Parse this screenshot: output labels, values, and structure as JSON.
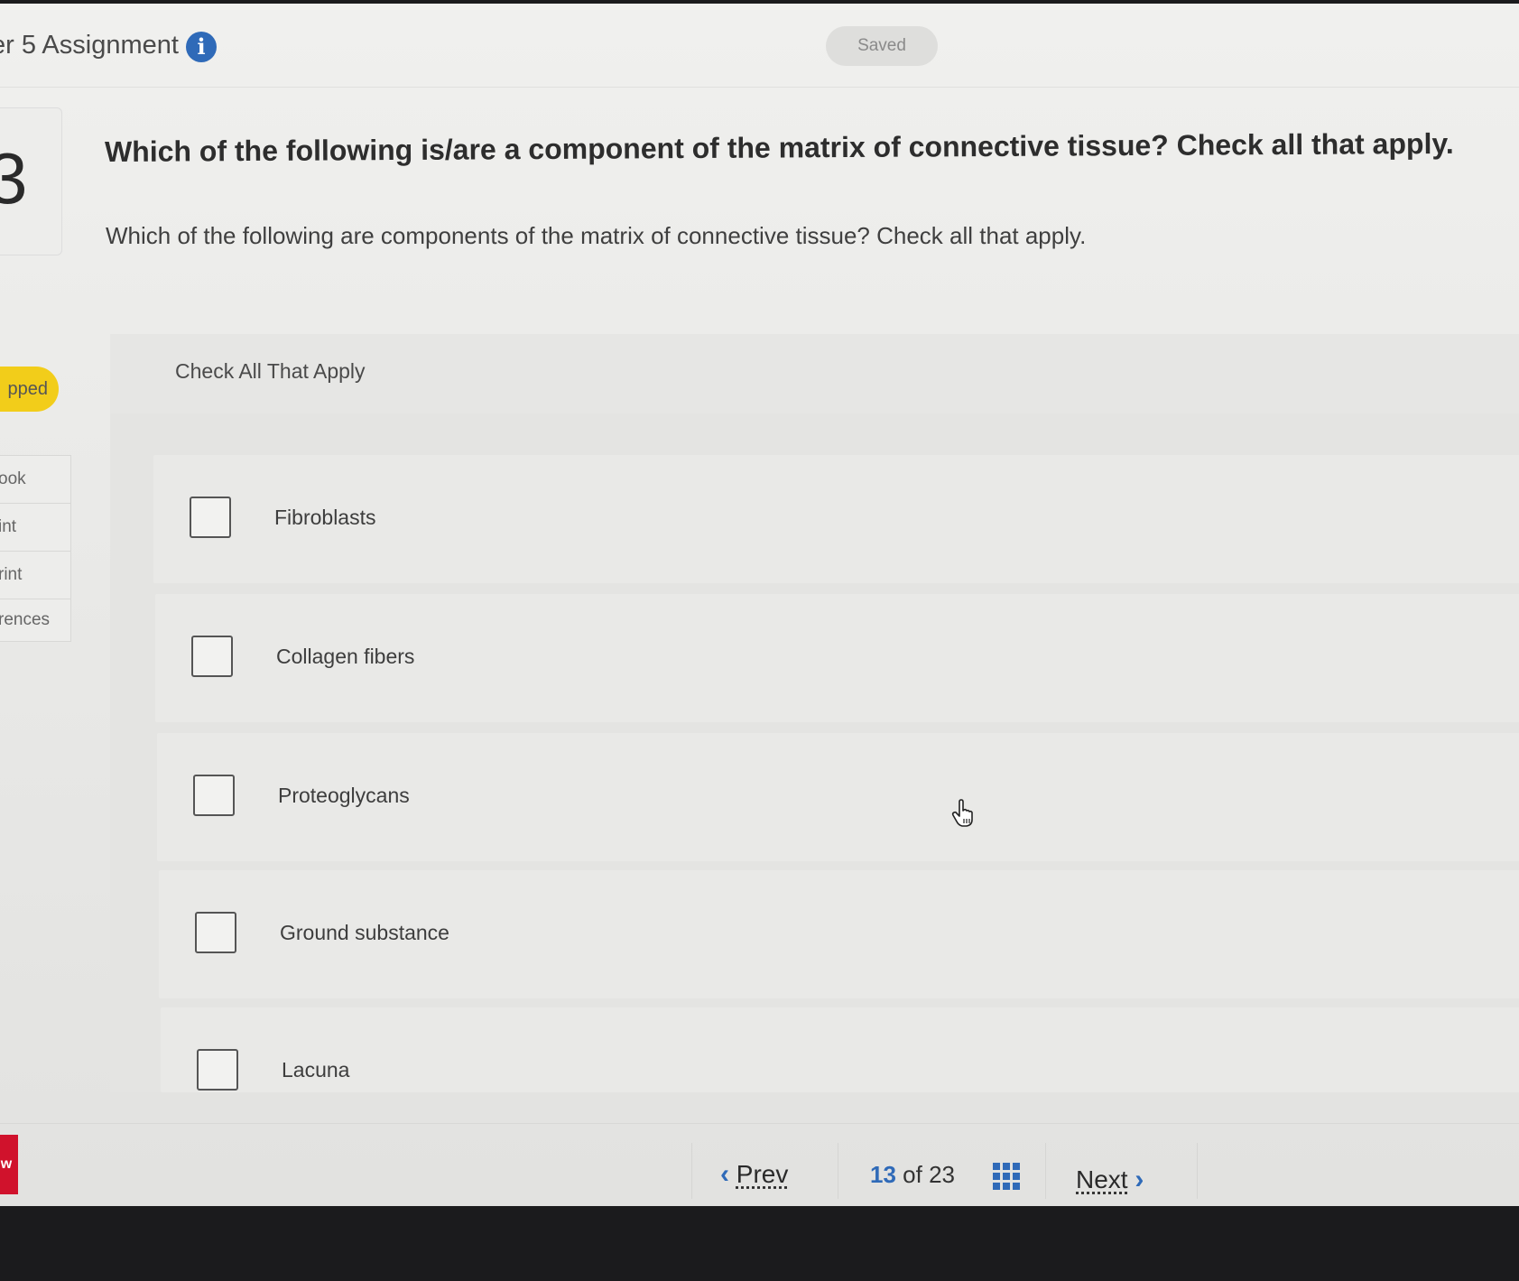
{
  "header": {
    "title": "er 5 Assignment",
    "info_icon": "info-icon",
    "save_status": "Saved"
  },
  "question": {
    "number": "3",
    "title": "Which of the following is/are a component of the matrix of connective tissue? Check all that apply.",
    "text": "Which of the following are components of the matrix of connective tissue? Check all that apply."
  },
  "sidebar": {
    "status_badge": "pped",
    "items": [
      {
        "label": "ook"
      },
      {
        "label": "int"
      },
      {
        "label": "rint"
      },
      {
        "label": "rences"
      }
    ]
  },
  "answer_panel": {
    "label": "Check All That Apply",
    "options": [
      {
        "label": "Fibroblasts",
        "checked": false
      },
      {
        "label": "Collagen fibers",
        "checked": false
      },
      {
        "label": "Proteoglycans",
        "checked": false
      },
      {
        "label": "Ground substance",
        "checked": false
      },
      {
        "label": "Lacuna",
        "checked": false
      }
    ]
  },
  "footer": {
    "brand": "w",
    "prev_label": "Prev",
    "current": "13",
    "of_label": "of",
    "total": "23",
    "next_label": "Next",
    "grid_icon": "grid-icon"
  },
  "colors": {
    "accent": "#2f6ab8",
    "badge": "#f2cd1a",
    "brand": "#d0122c"
  }
}
